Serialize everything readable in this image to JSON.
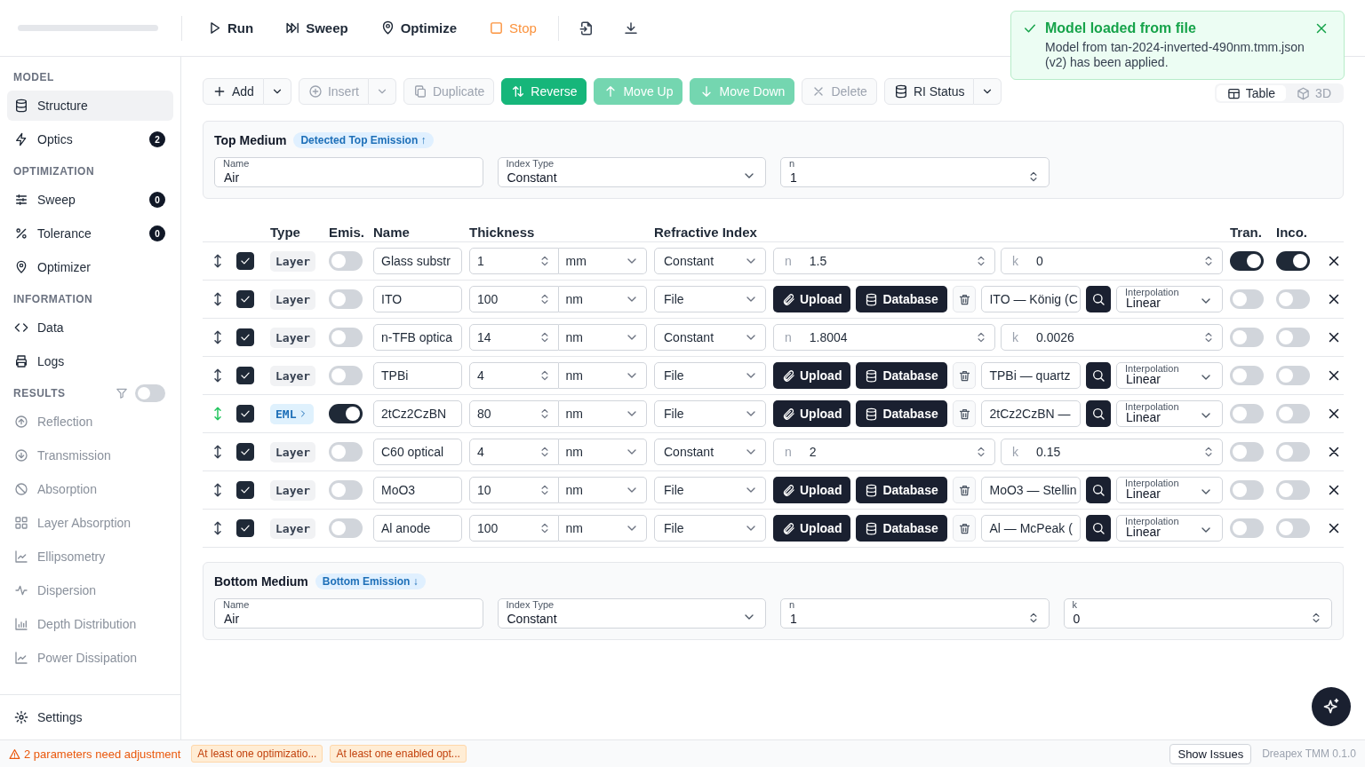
{
  "header": {
    "toolbar": [
      {
        "label": "Run",
        "kind": "run"
      },
      {
        "label": "Sweep",
        "kind": "sweep"
      },
      {
        "label": "Optimize",
        "kind": "optimize"
      },
      {
        "label": "Stop",
        "kind": "stop"
      }
    ]
  },
  "toast": {
    "title": "Model loaded from file",
    "message": "Model from tan-2024-inverted-490nm.tmm.json (v2) has been applied."
  },
  "sidebar": {
    "sections": [
      {
        "title": "MODEL",
        "items": [
          {
            "label": "Structure",
            "selected": true
          },
          {
            "label": "Optics",
            "badge": "2",
            "selected": false
          }
        ]
      },
      {
        "title": "OPTIMIZATION",
        "items": [
          {
            "label": "Sweep",
            "badge": "0",
            "selected": false
          },
          {
            "label": "Tolerance",
            "badge": "0",
            "selected": false
          },
          {
            "label": "Optimizer",
            "selected": false
          }
        ]
      },
      {
        "title": "INFORMATION",
        "items": [
          {
            "label": "Data",
            "selected": false
          },
          {
            "label": "Logs",
            "selected": false
          }
        ]
      },
      {
        "title": "RESULTS",
        "filter_on": false,
        "items": [
          {
            "label": "Reflection",
            "selected": false,
            "disabled": true
          },
          {
            "label": "Transmission",
            "selected": false,
            "disabled": true
          },
          {
            "label": "Absorption",
            "selected": false,
            "disabled": true
          },
          {
            "label": "Layer Absorption",
            "selected": false,
            "disabled": true
          },
          {
            "label": "Ellipsometry",
            "selected": false,
            "disabled": true
          },
          {
            "label": "Dispersion",
            "selected": false,
            "disabled": true
          },
          {
            "label": "Depth Distribution",
            "selected": false,
            "disabled": true
          },
          {
            "label": "Power Dissipation",
            "selected": false,
            "disabled": true
          }
        ]
      }
    ],
    "settings": "Settings"
  },
  "actions": [
    {
      "label": "Add",
      "kind": "add",
      "disabled": false,
      "menu": true
    },
    {
      "label": "Insert",
      "kind": "insert",
      "disabled": true,
      "menu": true
    },
    {
      "label": "Duplicate",
      "kind": "duplicate",
      "disabled": true,
      "menu": false
    },
    {
      "label": "Reverse",
      "kind": "reverse",
      "disabled": false,
      "menu": false
    },
    {
      "label": "Move Up",
      "kind": "move_up",
      "disabled": true,
      "menu": false
    },
    {
      "label": "Move Down",
      "kind": "move_down",
      "disabled": true,
      "menu": false
    },
    {
      "label": "Delete",
      "kind": "delete",
      "disabled": true,
      "menu": false
    },
    {
      "label": "RI Status",
      "kind": "ri_status",
      "disabled": false,
      "menu": true
    }
  ],
  "view_tabs": [
    {
      "label": "Table",
      "selected": true
    },
    {
      "label": "3D",
      "selected": false
    }
  ],
  "top_medium": {
    "title": "Top Medium",
    "badge": "Detected Top Emission ↑",
    "fields": [
      {
        "label": "Name",
        "value": "Air",
        "kind": "text"
      },
      {
        "label": "Index Type",
        "value": "Constant",
        "kind": "select"
      },
      {
        "label": "n",
        "value": "1",
        "kind": "number"
      }
    ]
  },
  "layers": {
    "columns": [
      "Type",
      "Emis.",
      "Name",
      "Thickness",
      "Refractive Index",
      "Tran.",
      "Inco."
    ],
    "rows": [
      {
        "kind": "layer",
        "type": "Layer",
        "enabled": true,
        "emission": false,
        "name": "Glass substr",
        "thickness": "1",
        "unit": "mm",
        "index_type": "Constant",
        "ri": {
          "kind": "constant",
          "n_label": "n",
          "n": "1.5",
          "k_label": "k",
          "k": "0"
        },
        "transparent": true,
        "incoherent": true
      },
      {
        "kind": "layer",
        "type": "Layer",
        "enabled": true,
        "emission": false,
        "name": "ITO",
        "thickness": "100",
        "unit": "nm",
        "index_type": "File",
        "ri": {
          "kind": "file",
          "upload": "Upload",
          "database": "Database",
          "material": "ITO — König (C",
          "interpolation_label": "Interpolation",
          "interpolation": "Linear"
        },
        "transparent": false,
        "incoherent": false
      },
      {
        "kind": "layer",
        "type": "Layer",
        "enabled": true,
        "emission": false,
        "name": "n-TFB optica",
        "thickness": "14",
        "unit": "nm",
        "index_type": "Constant",
        "ri": {
          "kind": "constant",
          "n_label": "n",
          "n": "1.8004",
          "k_label": "k",
          "k": "0.0026"
        },
        "transparent": false,
        "incoherent": false
      },
      {
        "kind": "layer",
        "type": "Layer",
        "enabled": true,
        "emission": false,
        "name": "TPBi",
        "thickness": "4",
        "unit": "nm",
        "index_type": "File",
        "ri": {
          "kind": "file",
          "upload": "Upload",
          "database": "Database",
          "material": "TPBi — quartz",
          "interpolation_label": "Interpolation",
          "interpolation": "Linear"
        },
        "transparent": false,
        "incoherent": false
      },
      {
        "kind": "eml",
        "type": "EML",
        "enabled": true,
        "emission": true,
        "name": "2tCz2CzBN",
        "thickness": "80",
        "unit": "nm",
        "index_type": "File",
        "ri": {
          "kind": "file",
          "upload": "Upload",
          "database": "Database",
          "material": "2tCz2CzBN —",
          "interpolation_label": "Interpolation",
          "interpolation": "Linear"
        },
        "transparent": false,
        "incoherent": false
      },
      {
        "kind": "layer",
        "type": "Layer",
        "enabled": true,
        "emission": false,
        "name": "C60 optical",
        "thickness": "4",
        "unit": "nm",
        "index_type": "Constant",
        "ri": {
          "kind": "constant",
          "n_label": "n",
          "n": "2",
          "k_label": "k",
          "k": "0.15"
        },
        "transparent": false,
        "incoherent": false
      },
      {
        "kind": "layer",
        "type": "Layer",
        "enabled": true,
        "emission": false,
        "name": "MoO3",
        "thickness": "10",
        "unit": "nm",
        "index_type": "File",
        "ri": {
          "kind": "file",
          "upload": "Upload",
          "database": "Database",
          "material": "MoO3 — Stellin",
          "interpolation_label": "Interpolation",
          "interpolation": "Linear"
        },
        "transparent": false,
        "incoherent": false
      },
      {
        "kind": "layer",
        "type": "Layer",
        "enabled": true,
        "emission": false,
        "name": "Al anode",
        "thickness": "100",
        "unit": "nm",
        "index_type": "File",
        "ri": {
          "kind": "file",
          "upload": "Upload",
          "database": "Database",
          "material": "Al — McPeak (",
          "interpolation_label": "Interpolation",
          "interpolation": "Linear"
        },
        "transparent": false,
        "incoherent": false
      }
    ]
  },
  "bottom_medium": {
    "title": "Bottom Medium",
    "badge": "Bottom Emission ↓",
    "fields": [
      {
        "label": "Name",
        "value": "Air",
        "kind": "text"
      },
      {
        "label": "Index Type",
        "value": "Constant",
        "kind": "select"
      },
      {
        "label": "n",
        "value": "1",
        "kind": "number"
      },
      {
        "label": "k",
        "value": "0",
        "kind": "number"
      }
    ]
  },
  "status_bar": {
    "warning": "2 parameters need adjustment",
    "chips": [
      "At least one optimizatio...",
      "At least one enabled opt..."
    ],
    "button": "Show Issues",
    "version": "Dreapex TMM 0.1.0"
  }
}
